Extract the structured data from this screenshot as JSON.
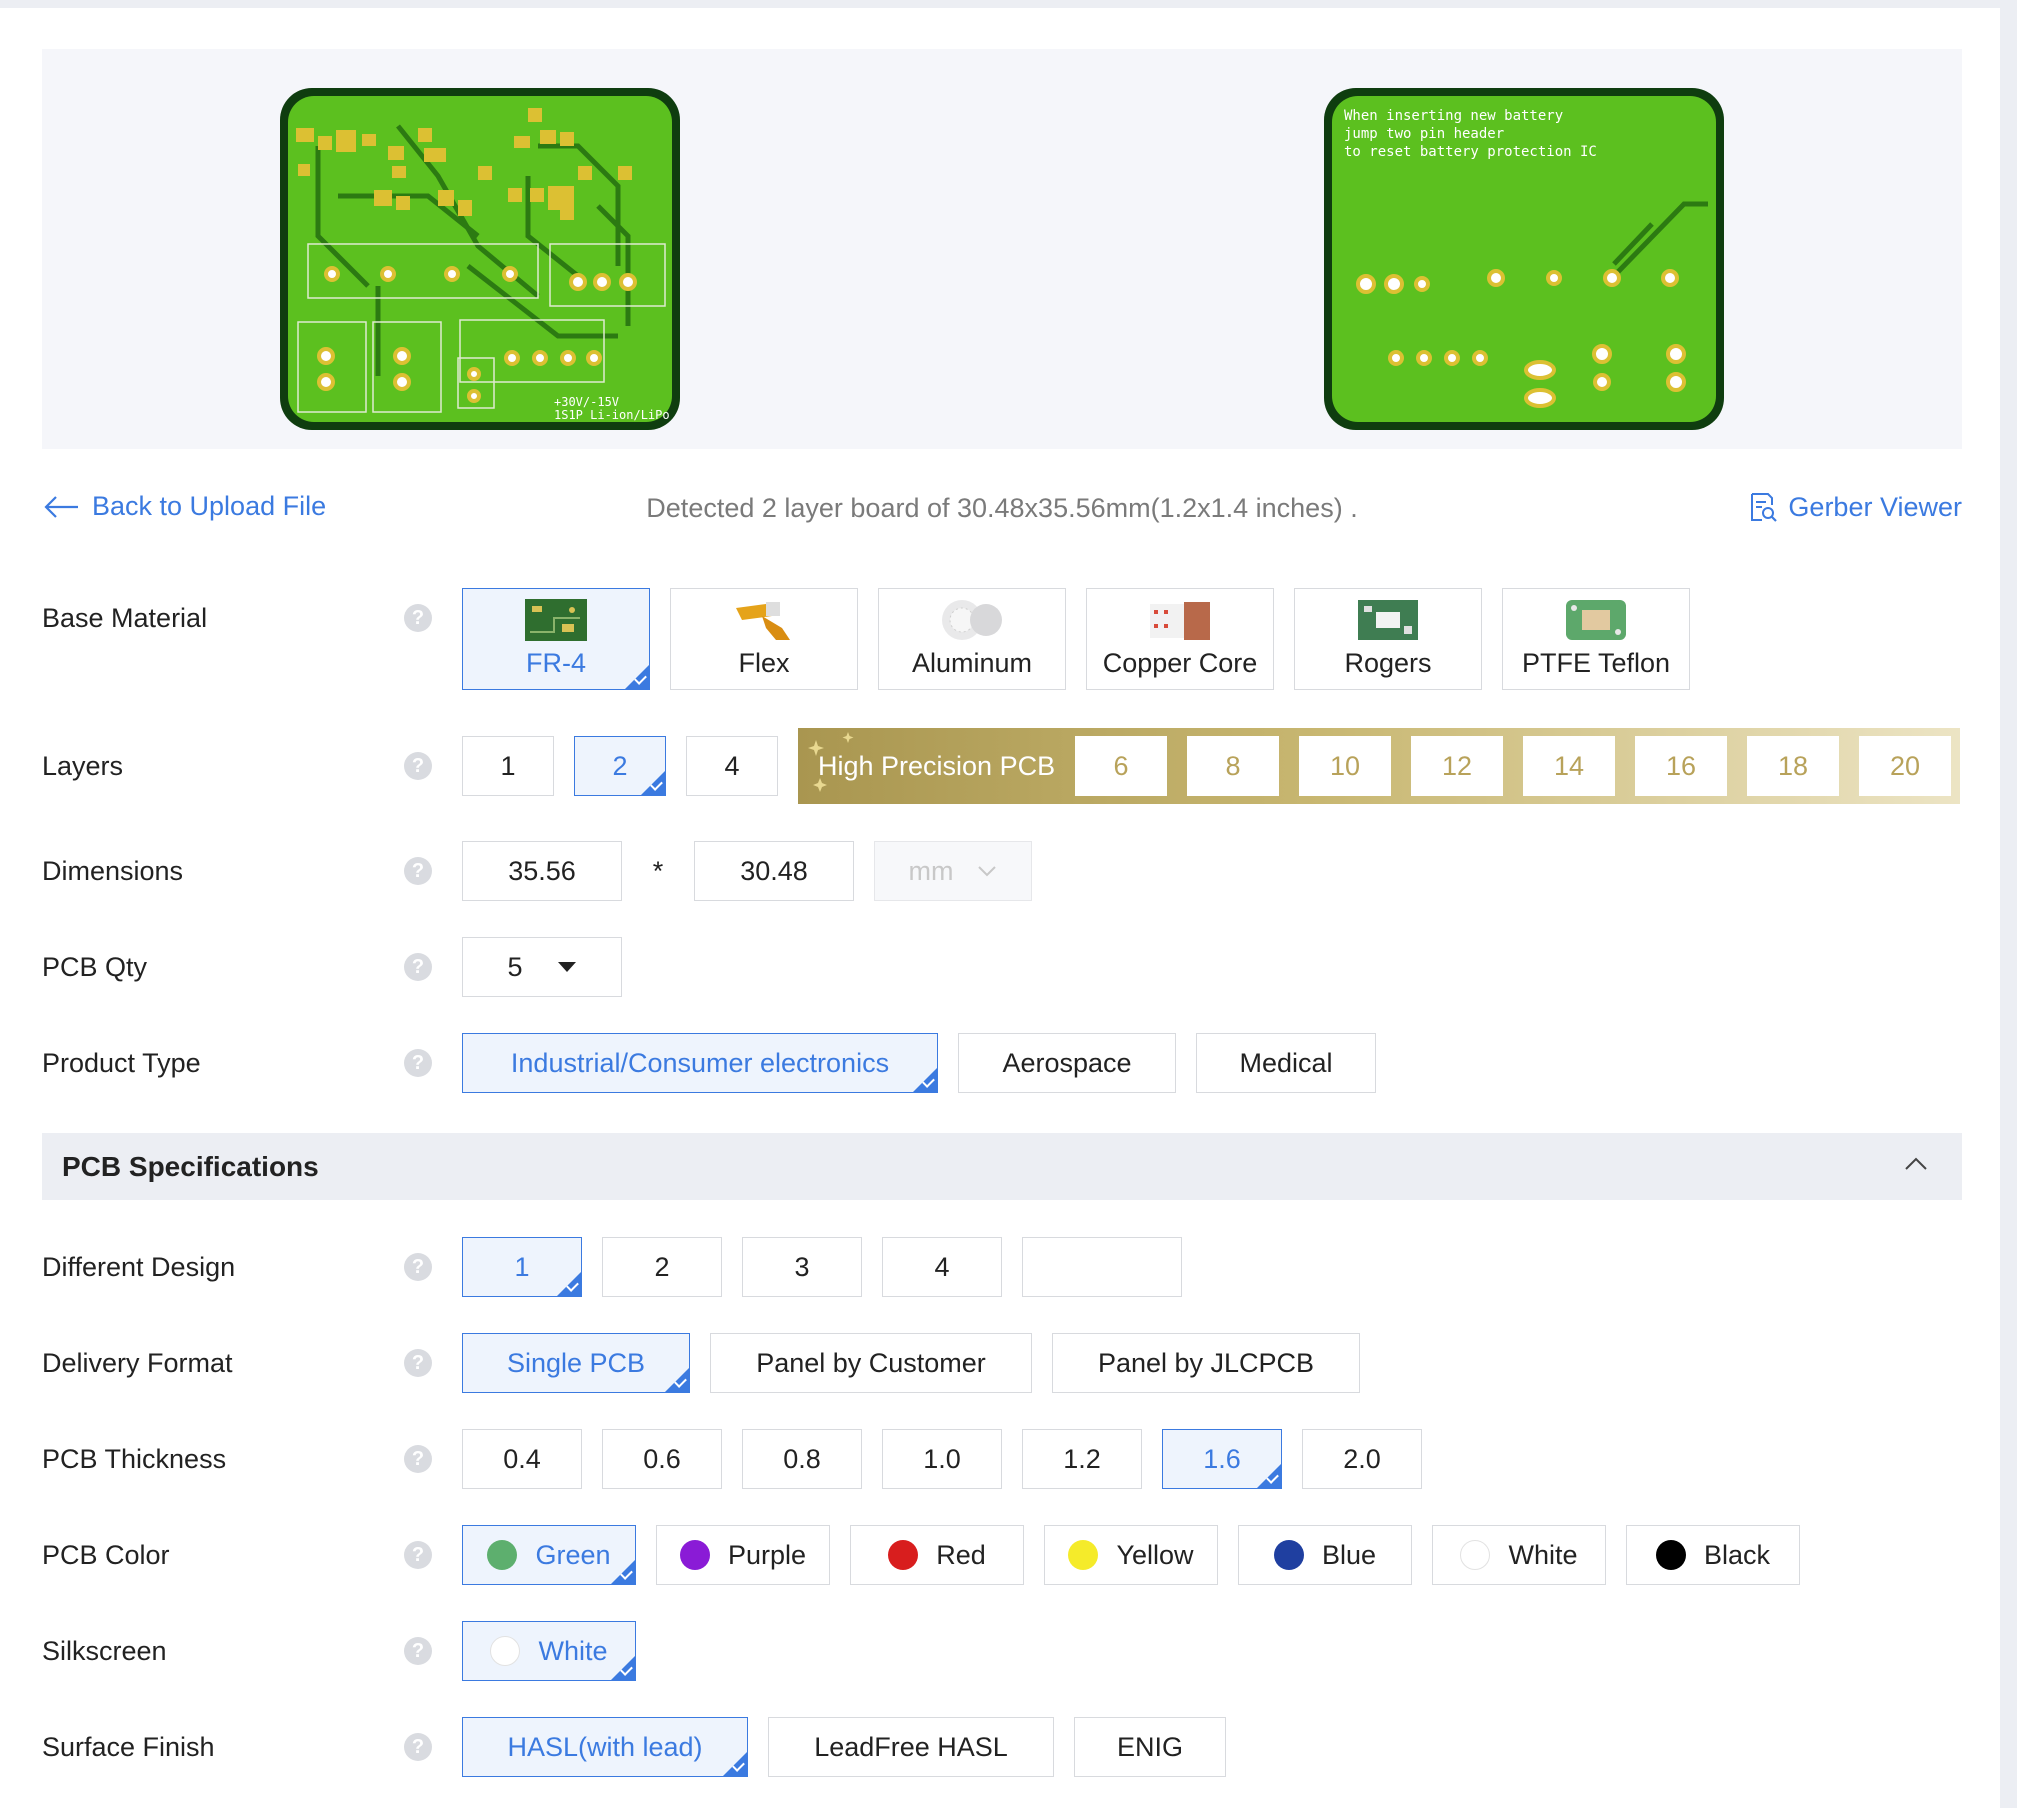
{
  "preview": {
    "top_silk": [
      "+30V/-15V",
      "1S1P Li-ion/LiPo"
    ],
    "bottom_silk": [
      "When inserting new battery",
      "jump two pin header",
      "to reset battery protection IC"
    ]
  },
  "header": {
    "back_label": "Back to Upload File",
    "detected_text": "Detected 2 layer board of 30.48x35.56mm(1.2x1.4 inches) .",
    "gerber_label": "Gerber Viewer"
  },
  "base_material": {
    "label": "Base Material",
    "options": [
      "FR-4",
      "Flex",
      "Aluminum",
      "Copper Core",
      "Rogers",
      "PTFE Teflon"
    ],
    "selected": "FR-4"
  },
  "layers": {
    "label": "Layers",
    "options": [
      "1",
      "2",
      "4"
    ],
    "selected": "2",
    "high_precision_label": "High Precision PCB",
    "high_precision_options": [
      "6",
      "8",
      "10",
      "12",
      "14",
      "16",
      "18",
      "20"
    ]
  },
  "dimensions": {
    "label": "Dimensions",
    "width": "35.56",
    "times": "*",
    "height": "30.48",
    "unit": "mm"
  },
  "qty": {
    "label": "PCB Qty",
    "value": "5"
  },
  "product_type": {
    "label": "Product Type",
    "options": [
      "Industrial/Consumer electronics",
      "Aerospace",
      "Medical"
    ],
    "selected": "Industrial/Consumer electronics"
  },
  "spec_section": {
    "title": "PCB Specifications"
  },
  "different_design": {
    "label": "Different Design",
    "options": [
      "1",
      "2",
      "3",
      "4"
    ],
    "custom_value": "",
    "selected": "1"
  },
  "delivery_format": {
    "label": "Delivery Format",
    "options": [
      "Single PCB",
      "Panel by Customer",
      "Panel by JLCPCB"
    ],
    "selected": "Single PCB"
  },
  "thickness": {
    "label": "PCB Thickness",
    "options": [
      "0.4",
      "0.6",
      "0.8",
      "1.0",
      "1.2",
      "1.6",
      "2.0"
    ],
    "selected": "1.6"
  },
  "color": {
    "label": "PCB Color",
    "options": [
      {
        "name": "Green",
        "hex": "#5daf6e"
      },
      {
        "name": "Purple",
        "hex": "#8a1bd6"
      },
      {
        "name": "Red",
        "hex": "#d81e1e"
      },
      {
        "name": "Yellow",
        "hex": "#f5eb2a"
      },
      {
        "name": "Blue",
        "hex": "#1f3fa0"
      },
      {
        "name": "White",
        "hex": "#ffffff"
      },
      {
        "name": "Black",
        "hex": "#000000"
      }
    ],
    "selected": "Green"
  },
  "silkscreen": {
    "label": "Silkscreen",
    "options": [
      {
        "name": "White",
        "hex": "#ffffff"
      }
    ],
    "selected": "White"
  },
  "surface_finish": {
    "label": "Surface Finish",
    "options": [
      "HASL(with lead)",
      "LeadFree HASL",
      "ENIG"
    ],
    "selected": "HASL(with lead)"
  },
  "help_glyph": "?",
  "colors": {
    "accent": "#3b7ae0",
    "pcb_green": "#5bbd2b",
    "gold": "#b8a25a"
  }
}
